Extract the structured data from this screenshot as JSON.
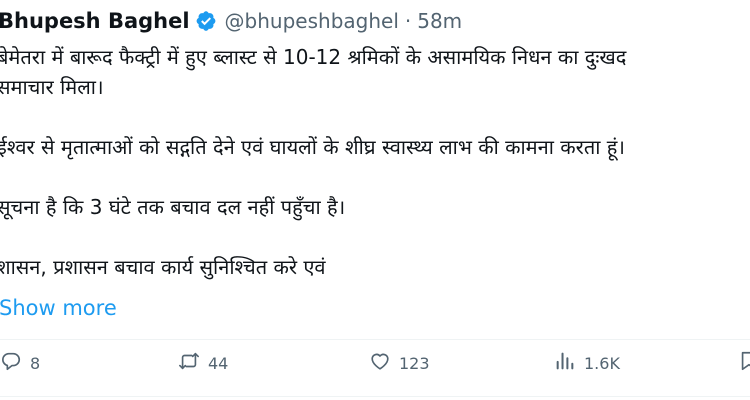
{
  "author": {
    "name": "Bhupesh Baghel",
    "handle": "@bhupeshbaghel",
    "separator": "·",
    "time": "58m",
    "verified_badge_color": "#1d9bf0"
  },
  "tweet": {
    "lines": [
      "बेमेतरा में बारूद फैक्ट्री में हुए ब्लास्ट से 10-12 श्रमिकों के असामयिक निधन का दुःखद",
      "समाचार मिला।",
      "",
      "ईश्वर से मृतात्माओं को सद्गति देने एवं घायलों के शीघ्र स्वास्थ्य लाभ की कामना करता हूं।",
      "",
      "सूचना है कि 3 घंटे तक बचाव दल नहीं पहुँचा है।",
      "",
      "शासन, प्रशासन बचाव कार्य सुनिश्चित करे एवं"
    ],
    "show_more": "Show more"
  },
  "actions": {
    "reply": {
      "icon": "reply-icon",
      "count": "8"
    },
    "repost": {
      "icon": "repost-icon",
      "count": "44"
    },
    "like": {
      "icon": "heart-icon",
      "count": "123"
    },
    "views": {
      "icon": "views-icon",
      "count": "1.6K"
    },
    "bookmark": {
      "icon": "bookmark-icon"
    }
  },
  "colors": {
    "text": "#0f1419",
    "secondary": "#536471",
    "link": "#1d9bf0"
  }
}
